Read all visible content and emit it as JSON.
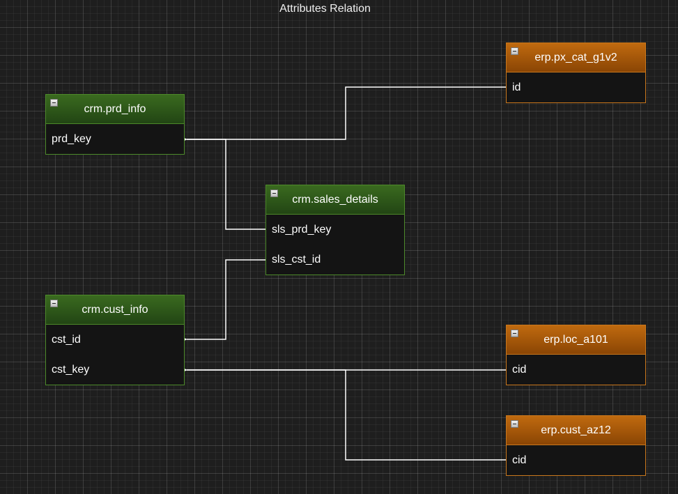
{
  "title": "Attributes Relation",
  "colors": {
    "source_table": "#2f5a1a",
    "erp_table": "#b35f0a",
    "edge": "#ffffff"
  },
  "tables": {
    "prd_info": {
      "name": "crm.prd_info",
      "columns": [
        "prd_key"
      ]
    },
    "sales_details": {
      "name": "crm.sales_details",
      "columns": [
        "sls_prd_key",
        "sls_cst_id"
      ]
    },
    "cust_info": {
      "name": "crm.cust_info",
      "columns": [
        "cst_id",
        "cst_key"
      ]
    },
    "px_cat": {
      "name": "erp.px_cat_g1v2",
      "columns": [
        "id"
      ]
    },
    "loc": {
      "name": "erp.loc_a101",
      "columns": [
        "cid"
      ]
    },
    "cust_az12": {
      "name": "erp.cust_az12",
      "columns": [
        "cid"
      ]
    }
  },
  "relations": [
    {
      "from": "erp.px_cat_g1v2.id",
      "to": "crm.prd_info.prd_key"
    },
    {
      "from": "crm.sales_details.sls_prd_key",
      "to": "crm.prd_info.prd_key"
    },
    {
      "from": "crm.sales_details.sls_cst_id",
      "to": "crm.cust_info.cst_id"
    },
    {
      "from": "erp.loc_a101.cid",
      "to": "crm.cust_info.cst_key"
    },
    {
      "from": "erp.cust_az12.cid",
      "to": "crm.cust_info.cst_key"
    }
  ]
}
